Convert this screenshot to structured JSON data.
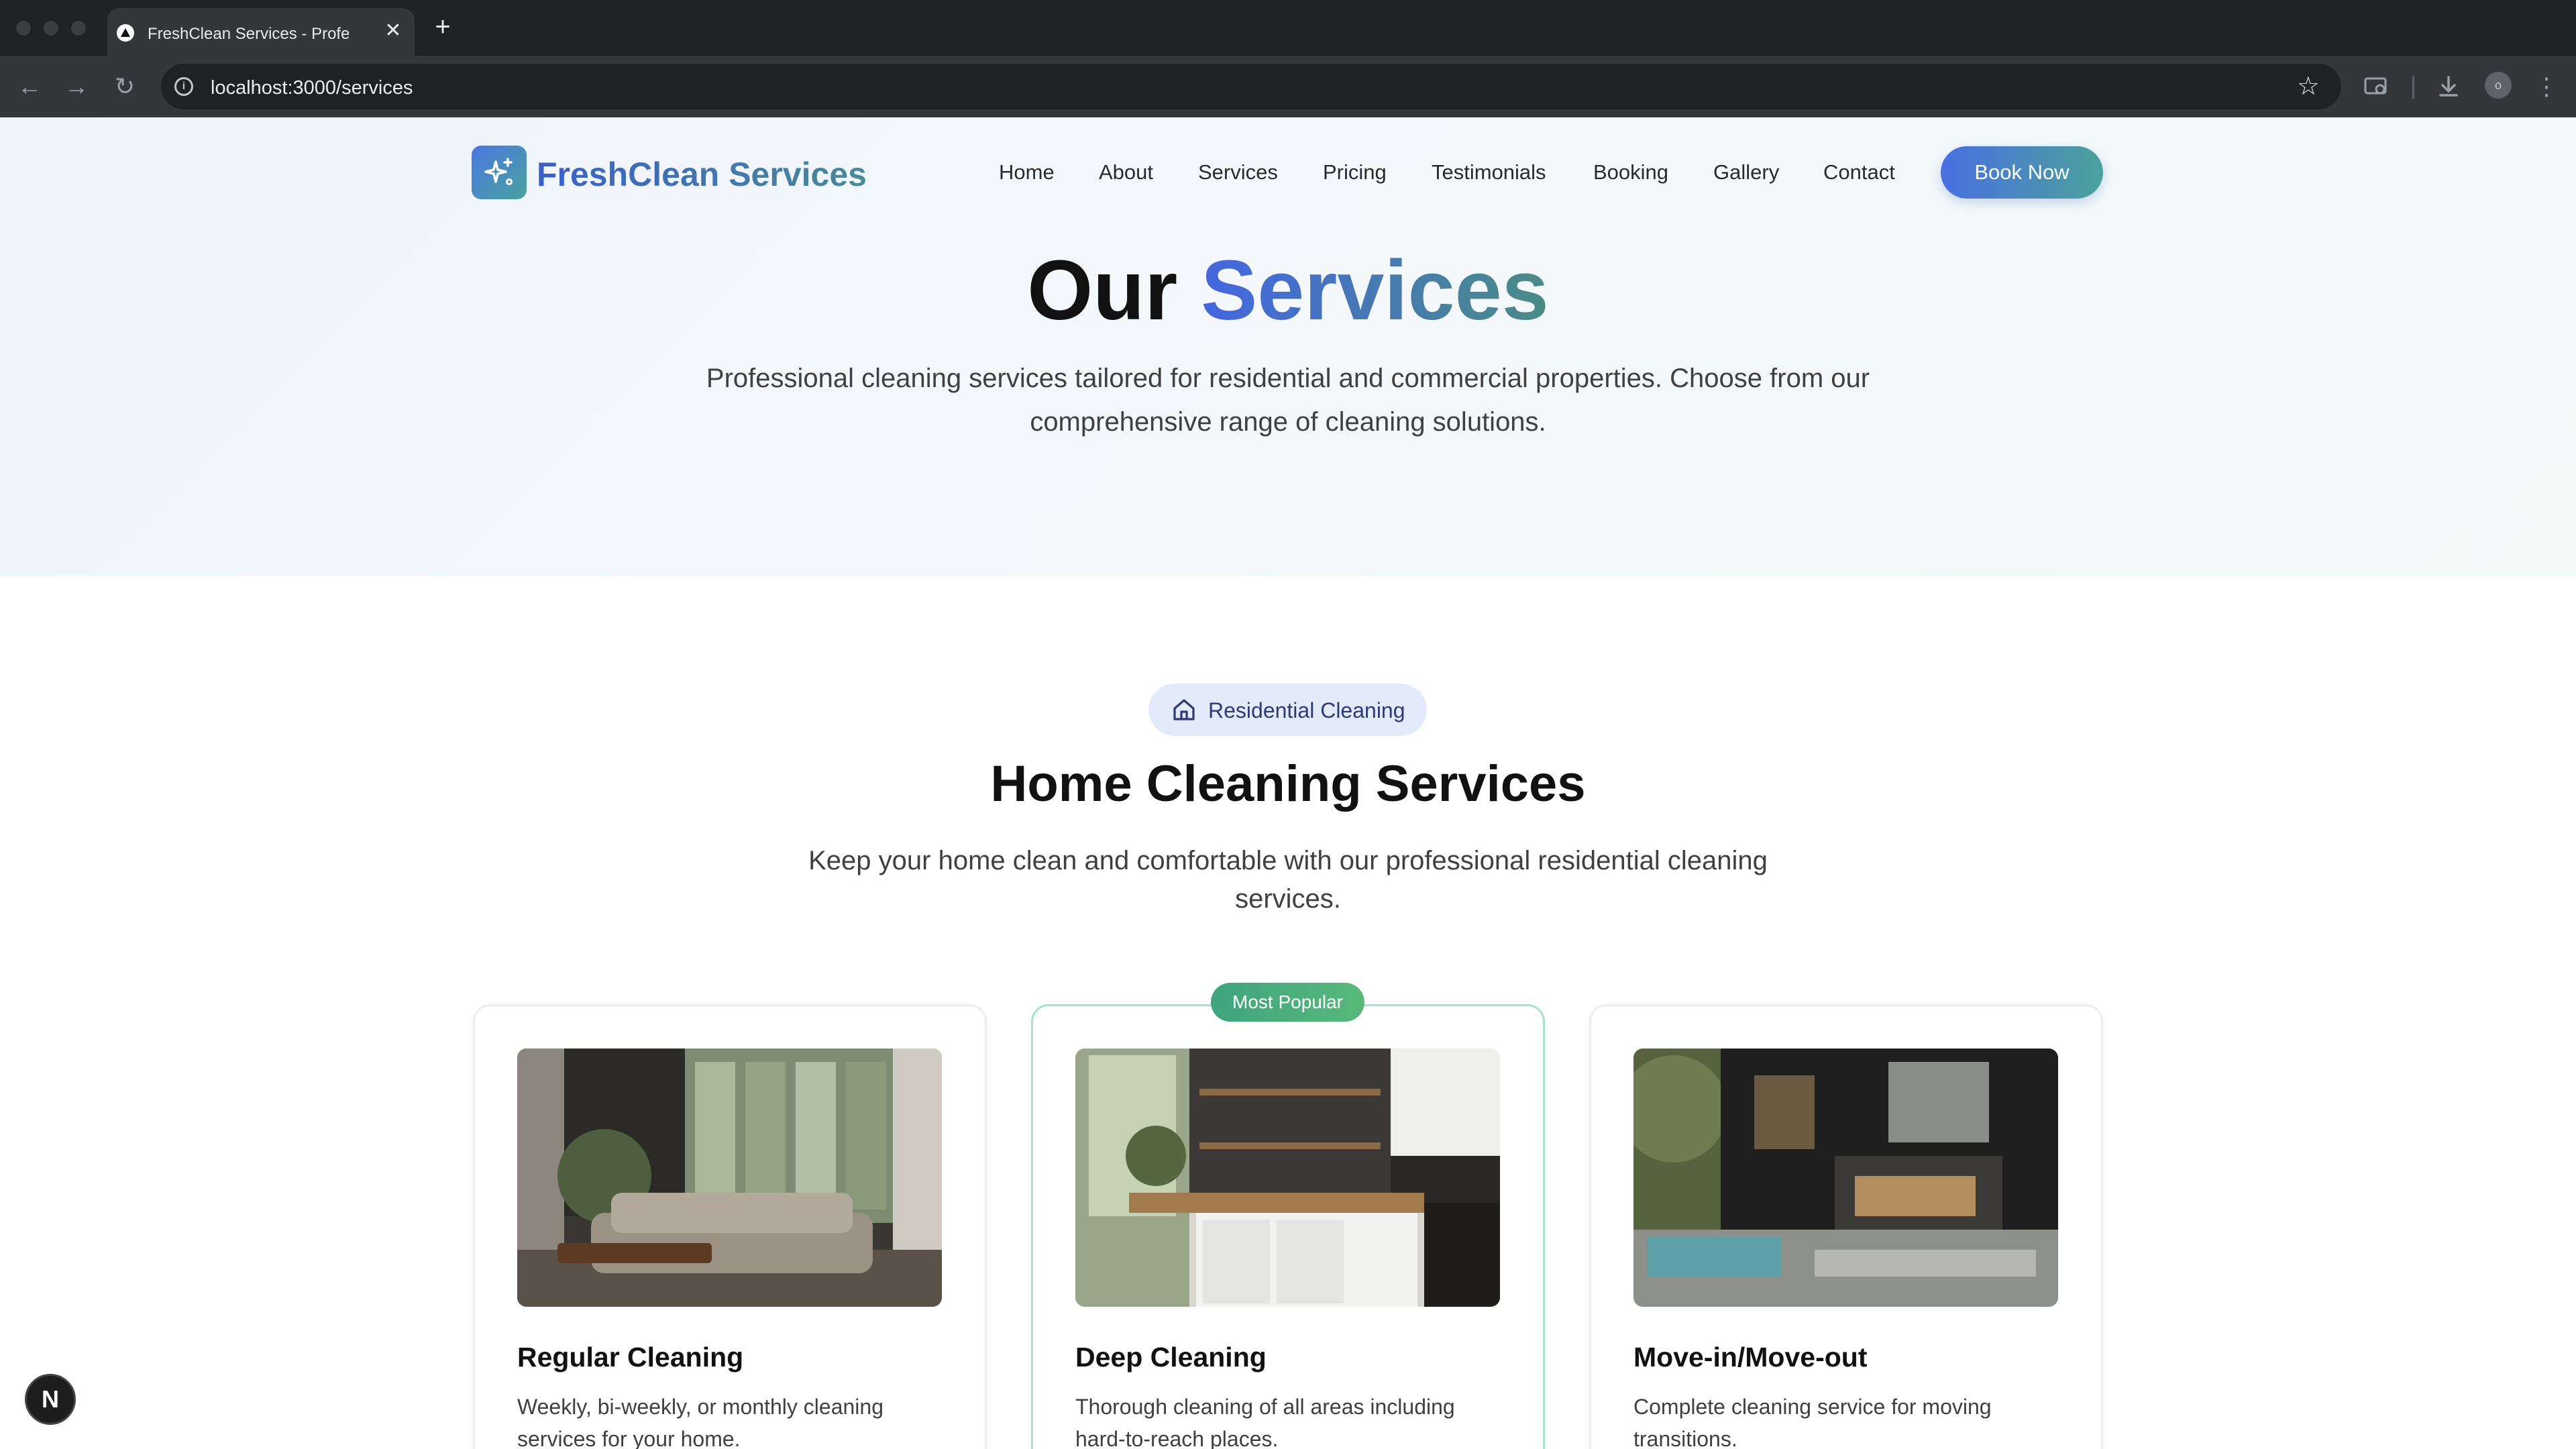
{
  "browser": {
    "tab_title": "FreshClean Services - Professional Cleaning",
    "tab_close": "✕",
    "new_tab": "+",
    "url": "localhost:3000/services",
    "back_icon": "←",
    "forward_icon": "→",
    "reload_icon": "↻",
    "star_icon": "☆",
    "profile_initial": "o"
  },
  "nav": {
    "brand": "FreshClean Services",
    "links": [
      "Home",
      "About",
      "Services",
      "Pricing",
      "Testimonials",
      "Booking",
      "Gallery",
      "Contact"
    ],
    "cta": "Book Now"
  },
  "hero": {
    "title_plain": "Our ",
    "title_accent": "Services",
    "subtitle": "Professional cleaning services tailored for residential and commercial properties. Choose from our comprehensive range of cleaning solutions."
  },
  "section": {
    "badge": "Residential Cleaning",
    "title": "Home Cleaning Services",
    "subtitle": "Keep your home clean and comfortable with our professional residential cleaning services."
  },
  "cards": [
    {
      "title": "Regular Cleaning",
      "desc": "Weekly, bi-weekly, or monthly cleaning services for your home."
    },
    {
      "title": "Deep Cleaning",
      "desc": "Thorough cleaning of all areas including hard-to-reach places.",
      "badge": "Most Popular"
    },
    {
      "title": "Move-in/Move-out",
      "desc": "Complete cleaning service for moving transitions."
    }
  ],
  "dev_indicator": "N",
  "colors": {
    "brand_blue": "#4466e0",
    "brand_teal": "#4aa29c",
    "popular_green": "#3fa47e"
  }
}
